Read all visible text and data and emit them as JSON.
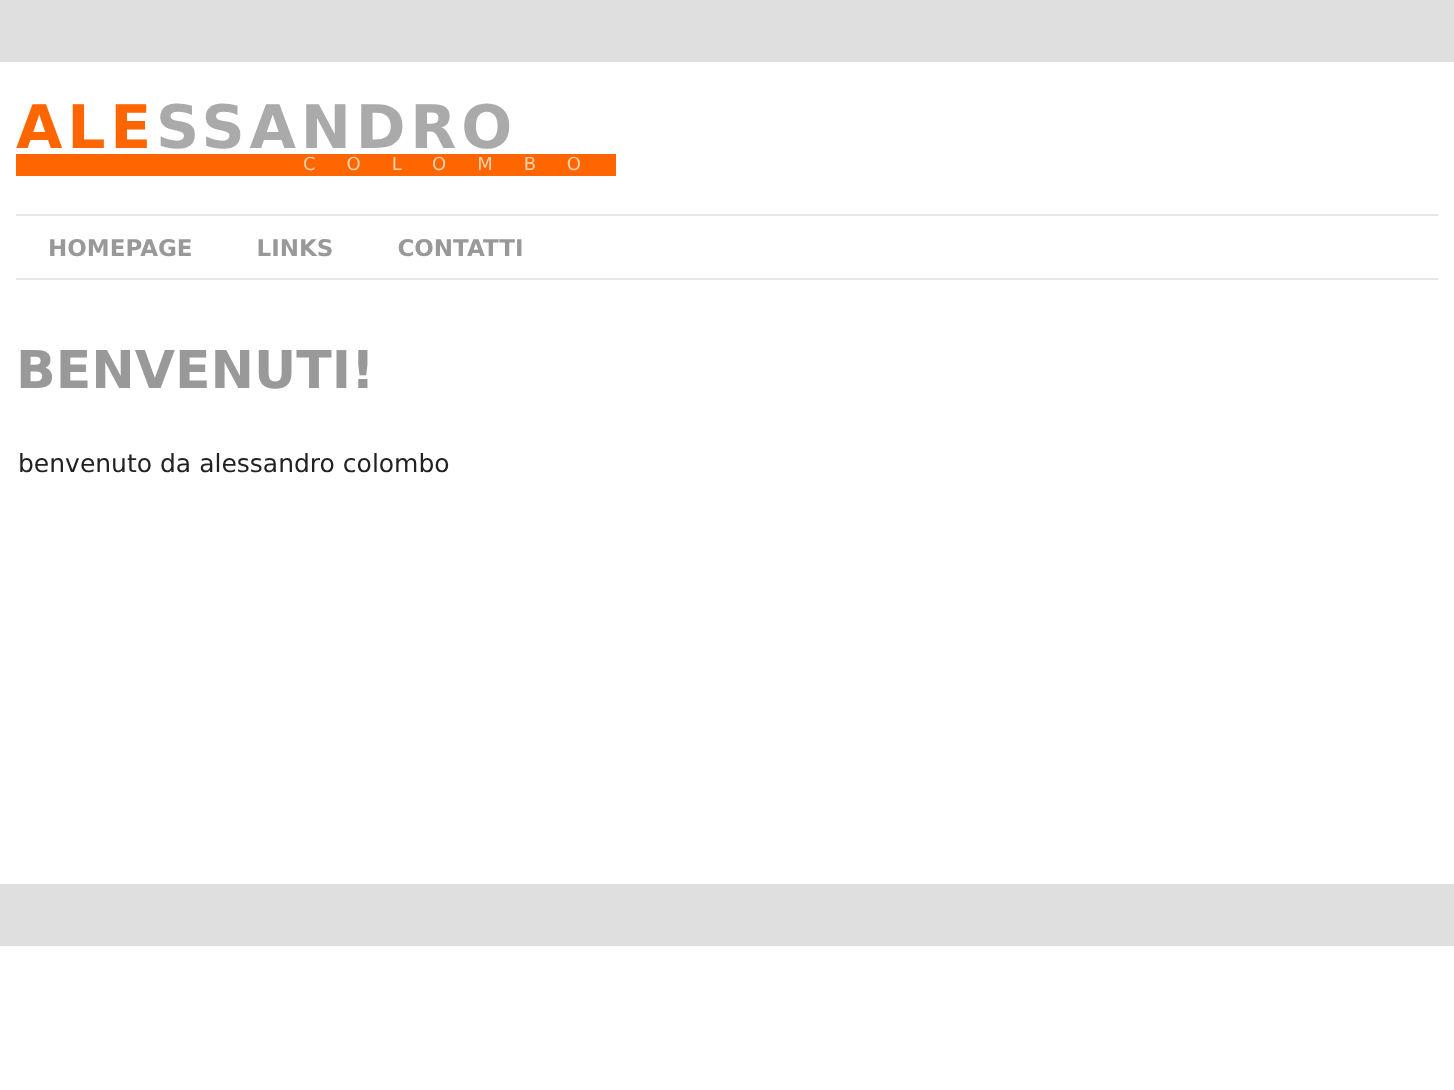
{
  "logo": {
    "accent": "ALE",
    "rest": "SSANDRO",
    "subtitle": "COLOMBO"
  },
  "nav": [
    {
      "label": "HOMEPAGE"
    },
    {
      "label": "LINKS"
    },
    {
      "label": "CONTATTI"
    }
  ],
  "content": {
    "heading": "BENVENUTI!",
    "text": "benvenuto da alessandro colombo"
  }
}
